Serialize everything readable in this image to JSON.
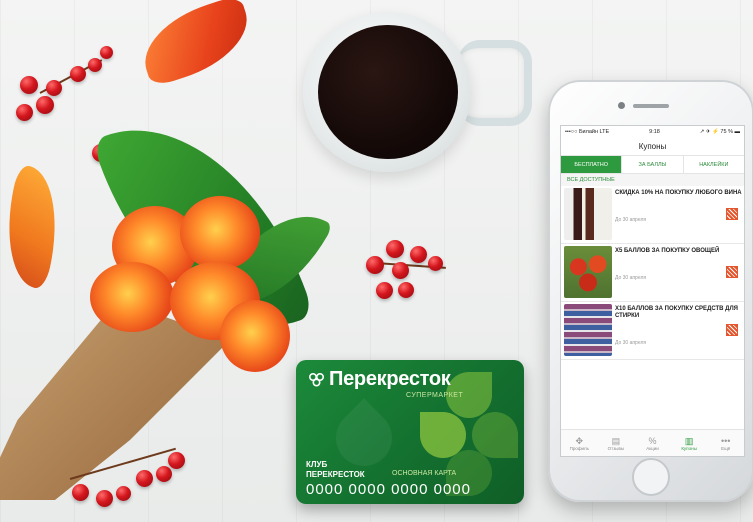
{
  "card": {
    "brand": "Перекресток",
    "subtitle": "СУПЕРМАРКЕТ",
    "club_line1": "КЛУБ",
    "club_line2": "ПЕРЕКРЕСТОК",
    "card_type": "ОСНОВНАЯ КАРТА",
    "number": "0000 0000 0000 0000"
  },
  "phone": {
    "status": {
      "carrier": "•••○○ Билайн LTE",
      "time": "9:18",
      "battery": "↗ ✈ ⚡ 75 % ▬"
    },
    "title": "Купоны",
    "tabs": [
      {
        "label": "Бесплатно",
        "active": true
      },
      {
        "label": "За баллы",
        "active": false
      },
      {
        "label": "Наклейки",
        "active": false
      }
    ],
    "section_label": "Все доступные",
    "coupons": [
      {
        "title": "Скидка 10% на покупку любого вина",
        "date": "До 30 апреля"
      },
      {
        "title": "x5 баллов за покупку овощей",
        "date": "До 30 апреля"
      },
      {
        "title": "x10 баллов за покупку средств для стирки",
        "date": "До 30 апреля"
      }
    ],
    "bottom_nav": [
      {
        "icon": "✥",
        "label": "Профиль"
      },
      {
        "icon": "▤",
        "label": "Отзывы"
      },
      {
        "icon": "%",
        "label": "Акции"
      },
      {
        "icon": "▥",
        "label": "Купоны"
      },
      {
        "icon": "•••",
        "label": "Ещё"
      }
    ]
  },
  "colors": {
    "brand_green": "#2e9a3f",
    "card_green": "#157531",
    "accent_orange": "#e4572e"
  }
}
